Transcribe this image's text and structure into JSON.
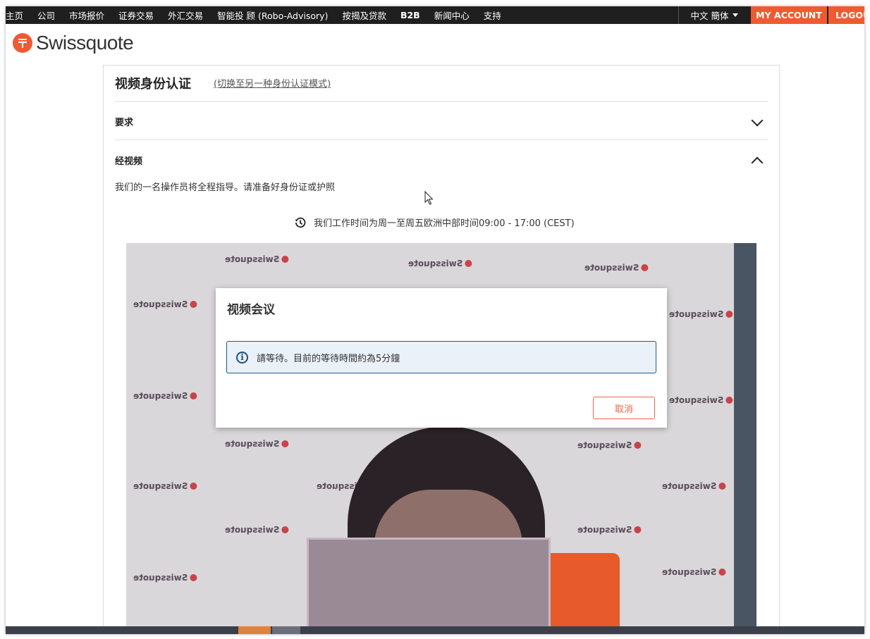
{
  "nav": {
    "items": [
      {
        "label": "主页",
        "bold": false
      },
      {
        "label": "公司",
        "bold": false
      },
      {
        "label": "市场报价",
        "bold": false
      },
      {
        "label": "证券交易",
        "bold": false
      },
      {
        "label": "外汇交易",
        "bold": false
      },
      {
        "label": "智能投 顾 (Robo-Advisory)",
        "bold": false
      },
      {
        "label": "按揭及贷款",
        "bold": false
      },
      {
        "label": "B2B",
        "bold": true
      },
      {
        "label": "新闻中心",
        "bold": false
      },
      {
        "label": "支持",
        "bold": false
      }
    ],
    "language": "中文 簡体",
    "my_account": "MY ACCOUNT",
    "logout": "LOGOUT"
  },
  "brand": {
    "name": "Swissquote",
    "accent_color": "#f05a31"
  },
  "card": {
    "title": "视频身份认证",
    "switch_link": "(切换至另一种身份认证模式)",
    "sections": [
      {
        "label": "要求",
        "expanded": false
      },
      {
        "label": "经视频",
        "expanded": true
      }
    ],
    "instruction": "我们的一名操作员将全程指导。请准备好身份证或护照",
    "hours": "我们工作时间为周一至周五欧洲中部时间09:00 - 17:00 (CEST)"
  },
  "video": {
    "watermark": "Swissquote"
  },
  "modal": {
    "title": "视频会议",
    "alert_message": "請等待。目前的等待時間約為5分鐘",
    "cancel_label": "取消"
  }
}
